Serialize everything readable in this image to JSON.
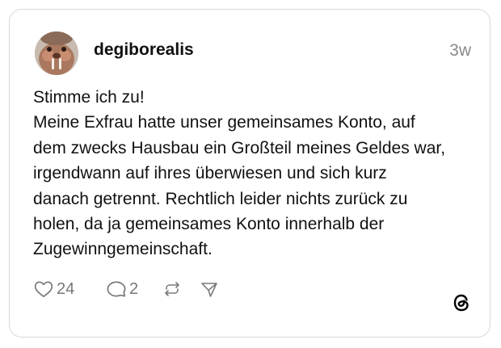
{
  "post": {
    "username": "degiborealis",
    "timestamp": "3w",
    "text": "Stimme ich zu!\nMeine Exfrau hatte unser gemeinsames Konto, auf\ndem zwecks Hausbau ein Großteil meines Geldes war,\nirgendwann auf ihres überwiesen und sich kurz\ndanach getrennt. Rechtlich leider nichts zurück zu\nholen, da ja gemeinsames Konto innerhalb der\nZugewinngemeinschaft."
  },
  "actions": {
    "likes": "24",
    "replies": "2",
    "like_icon": "heart-icon",
    "reply_icon": "speech-bubble-icon",
    "repost_icon": "repost-icon",
    "share_icon": "send-icon"
  },
  "brand": {
    "logo": "threads-logo-icon"
  },
  "colors": {
    "text": "#111111",
    "muted": "#8a8a8a",
    "border": "#d9d9d9"
  }
}
